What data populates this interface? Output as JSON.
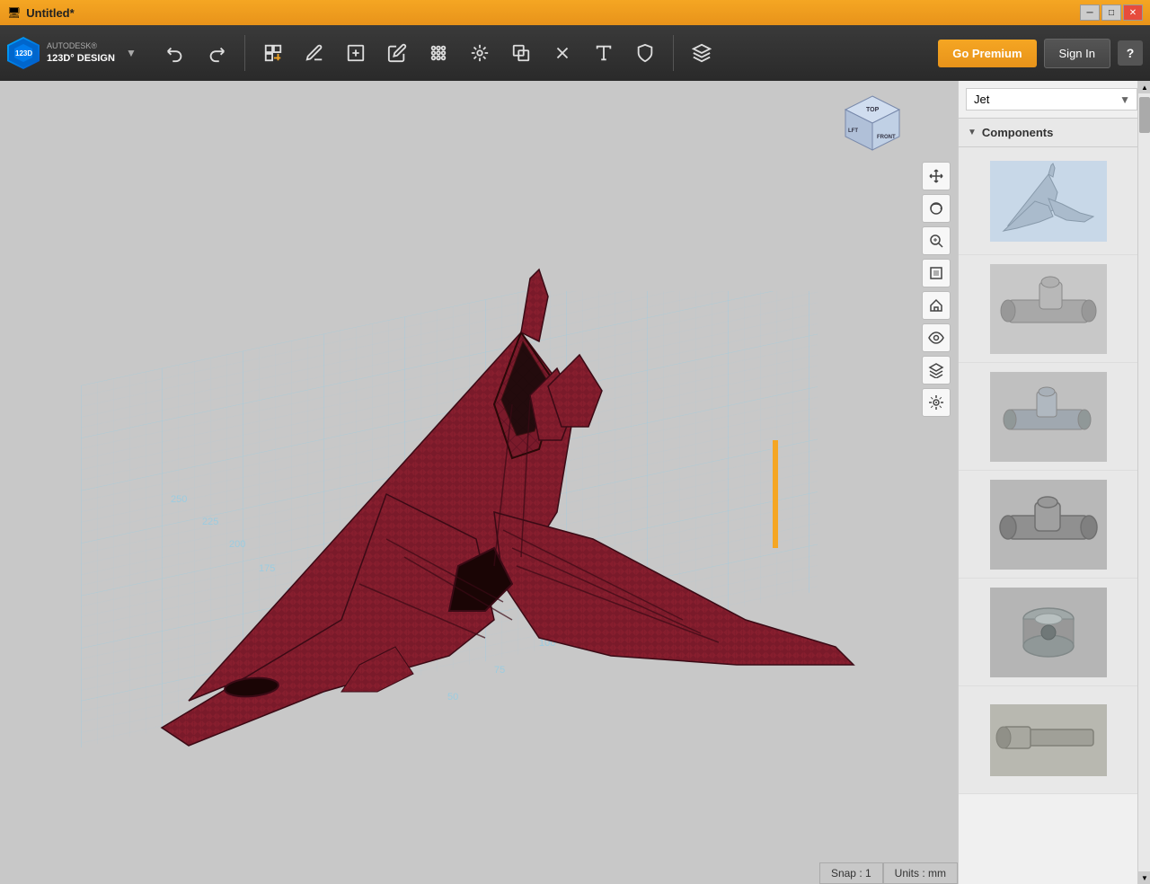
{
  "window": {
    "title": "Untitled*"
  },
  "toolbar": {
    "undo_label": "↩",
    "redo_label": "↪",
    "premium_label": "Go Premium",
    "signin_label": "Sign In",
    "help_label": "?",
    "brand": "AUTODESK®",
    "product": "123D° DESIGN"
  },
  "viewport": {
    "snap_label": "Snap : 1",
    "units_label": "Units : mm"
  },
  "sidebar": {
    "dropdown_value": "Jet",
    "components_label": "Components",
    "items": [
      {
        "id": 1,
        "label": "Jet plane component"
      },
      {
        "id": 2,
        "label": "Cylinder component 1"
      },
      {
        "id": 3,
        "label": "Cylinder component 2"
      },
      {
        "id": 4,
        "label": "Cylinder component 3"
      },
      {
        "id": 5,
        "label": "Round component"
      },
      {
        "id": 6,
        "label": "Part component"
      }
    ]
  },
  "viewcube": {
    "top_label": "TOP",
    "left_label": "LFT",
    "front_label": "FRONT"
  },
  "view_tools": {
    "pan": "+",
    "orbit": "⟳",
    "zoom": "🔍",
    "fit": "⊡",
    "home": "⌂",
    "eye": "👁",
    "layers": "≡",
    "snap": "🔗"
  }
}
